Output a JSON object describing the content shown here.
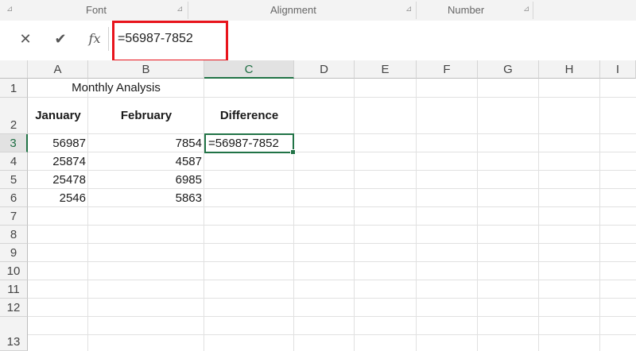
{
  "ribbon": {
    "groups": [
      {
        "label": "Font"
      },
      {
        "label": "Alignment"
      },
      {
        "label": "Number"
      }
    ]
  },
  "formula_bar": {
    "cancel_symbol": "✕",
    "enter_symbol": "✔",
    "fx_label": "fx",
    "formula": "=56987-7852",
    "highlight_color": "#e8141c"
  },
  "grid": {
    "column_headers": [
      "A",
      "B",
      "C",
      "D",
      "E",
      "F",
      "G",
      "H",
      "I"
    ],
    "row_headers": [
      "1",
      "2",
      "3",
      "4",
      "5",
      "6",
      "7",
      "8",
      "9",
      "10",
      "11",
      "12",
      "13"
    ],
    "selected_column": "C",
    "selected_row": "3",
    "title": "Monthly Analysis",
    "headers": {
      "january": "January",
      "february": "February",
      "difference": "Difference"
    },
    "rows": [
      {
        "january": "56987",
        "february": "7854"
      },
      {
        "january": "25874",
        "february": "4587"
      },
      {
        "january": "25478",
        "february": "6985"
      },
      {
        "january": "2546",
        "february": "5863"
      }
    ],
    "active_cell_content": "=56987-7852",
    "accent_color": "#217346"
  }
}
